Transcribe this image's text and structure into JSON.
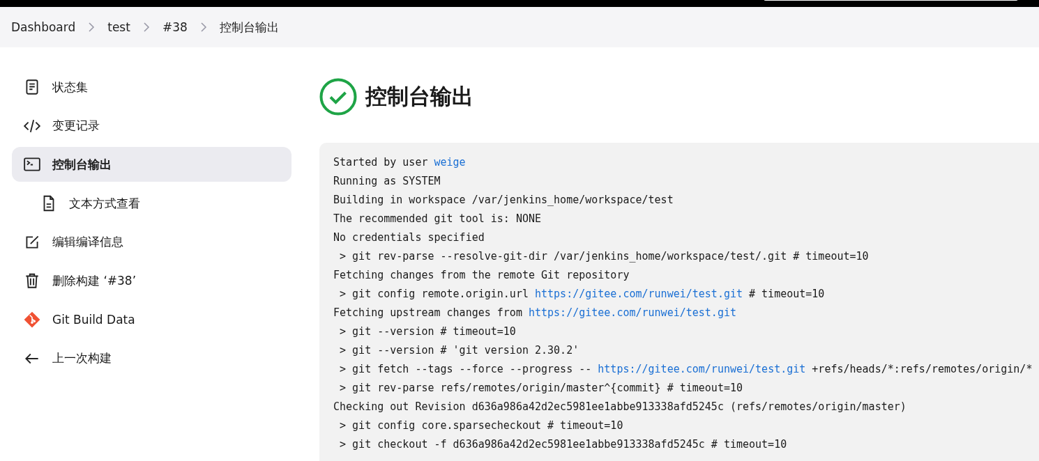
{
  "breadcrumbs": [
    "Dashboard",
    "test",
    "#38",
    "控制台输出"
  ],
  "sidebar": {
    "items": [
      {
        "label": "状态集",
        "kind": "document",
        "selected": false
      },
      {
        "label": "变更记录",
        "kind": "code",
        "selected": false
      },
      {
        "label": "控制台输出",
        "kind": "terminal",
        "selected": true,
        "children": [
          {
            "label": "文本方式查看",
            "kind": "file",
            "selected": false
          }
        ]
      },
      {
        "label": "编辑编译信息",
        "kind": "edit",
        "selected": false
      },
      {
        "label": "删除构建 ‘#38’",
        "kind": "trash",
        "selected": false
      },
      {
        "label": "Git Build Data",
        "kind": "git",
        "selected": false
      },
      {
        "label": "上一次构建",
        "kind": "back",
        "selected": false
      }
    ]
  },
  "page": {
    "title": "控制台输出"
  },
  "console": {
    "lines": [
      [
        {
          "text": "Started by user "
        },
        {
          "text": "weige",
          "link": true
        }
      ],
      [
        {
          "text": "Running as SYSTEM"
        }
      ],
      [
        {
          "text": "Building in workspace /var/jenkins_home/workspace/test"
        }
      ],
      [
        {
          "text": "The recommended git tool is: NONE"
        }
      ],
      [
        {
          "text": "No credentials specified"
        }
      ],
      [
        {
          "text": " > git rev-parse --resolve-git-dir /var/jenkins_home/workspace/test/.git # timeout=10"
        }
      ],
      [
        {
          "text": "Fetching changes from the remote Git repository"
        }
      ],
      [
        {
          "text": " > git config remote.origin.url "
        },
        {
          "text": "https://gitee.com/runwei/test.git",
          "link": true
        },
        {
          "text": " # timeout=10"
        }
      ],
      [
        {
          "text": "Fetching upstream changes from "
        },
        {
          "text": "https://gitee.com/runwei/test.git",
          "link": true
        }
      ],
      [
        {
          "text": " > git --version # timeout=10"
        }
      ],
      [
        {
          "text": " > git --version # 'git version 2.30.2'"
        }
      ],
      [
        {
          "text": " > git fetch --tags --force --progress -- "
        },
        {
          "text": "https://gitee.com/runwei/test.git",
          "link": true
        },
        {
          "text": " +refs/heads/*:refs/remotes/origin/*"
        }
      ],
      [
        {
          "text": " > git rev-parse refs/remotes/origin/master^{commit} # timeout=10"
        }
      ],
      [
        {
          "text": "Checking out Revision d636a986a42d2ec5981ee1abbe913338afd5245c (refs/remotes/origin/master)"
        }
      ],
      [
        {
          "text": " > git config core.sparsecheckout # timeout=10"
        }
      ],
      [
        {
          "text": " > git checkout -f d636a986a42d2ec5981ee1abbe913338afd5245c # timeout=10"
        }
      ]
    ]
  }
}
